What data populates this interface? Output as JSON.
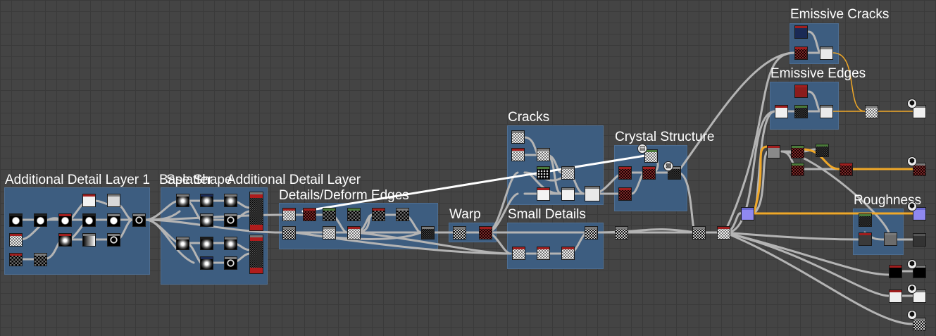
{
  "frames": {
    "emissive_cracks": "Emissive Cracks",
    "emissive_edges": "Emissive Edges",
    "cracks": "Cracks",
    "crystal_structure": "Crystal Structure",
    "additional_detail_layer_1": "Additional Detail Layer 1",
    "base_shape": "Base Shape",
    "splatter": "Splatter",
    "additional_detail_layer_2": "Additional Detail Layer",
    "details_deform_edges": "Details/Deform Edges",
    "warp": "Warp",
    "small_details": "Small Details",
    "roughness": "Roughness"
  },
  "icons": {
    "output_badge": "output-icon",
    "comment_badge": "comment-icon"
  },
  "colors": {
    "canvas_bg": "#444444",
    "frame_bg": "#3d5d80",
    "wire_grey": "#b4b4b4",
    "wire_orange": "#f0a828",
    "wire_white": "#ffffff",
    "header_red": "#a01e1e",
    "header_green": "#4a7a3a",
    "header_grey": "#7a7a7a",
    "header_black": "#1c1c1c"
  }
}
